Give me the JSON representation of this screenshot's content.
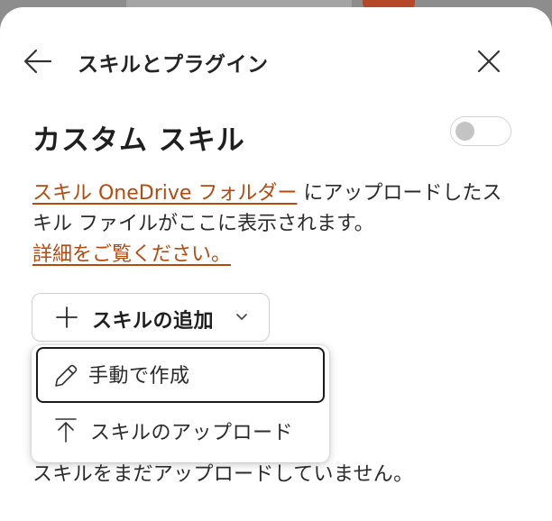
{
  "header": {
    "title": "スキルとプラグイン",
    "back_icon": "arrow-left-icon",
    "close_icon": "close-icon"
  },
  "section": {
    "title": "カスタム スキル",
    "toggle_on": false
  },
  "description": {
    "link_folder": "スキル OneDrive フォルダー",
    "text": " にアップロードしたスキル ファイルがここに表示されます。",
    "link_details": "詳細をご覧ください。"
  },
  "add_button": {
    "label": "スキルの追加",
    "icon": "plus-icon",
    "chevron": "chevron-down-icon"
  },
  "menu": {
    "items": [
      {
        "label": "手動で作成",
        "icon": "pencil-icon"
      },
      {
        "label": "スキルのアップロード",
        "icon": "upload-icon"
      }
    ]
  },
  "empty_state": "スキルをまだアップロードしていません。",
  "colors": {
    "link": "#b34a10",
    "avatar": "#b6482a",
    "text": "#2b2b2b"
  }
}
